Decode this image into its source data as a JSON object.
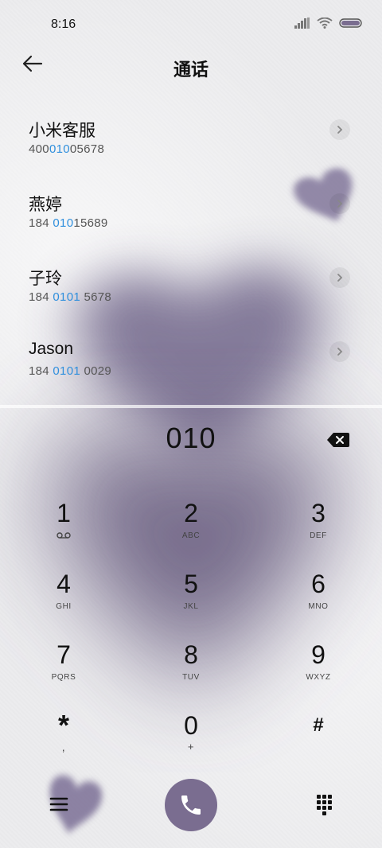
{
  "status_bar": {
    "time": "8:16"
  },
  "header": {
    "title": "通话"
  },
  "contacts": [
    {
      "name": "小米客服",
      "number_pre": "400",
      "number_match": "010",
      "number_post": "05678"
    },
    {
      "name": "燕婷",
      "number_pre": "184 ",
      "number_match": "010",
      "number_post": "15689"
    },
    {
      "name": "子玲",
      "number_pre": "184 ",
      "number_match": "0101",
      "number_post": " 5678"
    },
    {
      "name": "Jason",
      "number_pre": "184 ",
      "number_match": "0101",
      "number_post": " 0029"
    }
  ],
  "dialer": {
    "input": "010"
  },
  "keypad": [
    {
      "digit": "1",
      "letters": ""
    },
    {
      "digit": "2",
      "letters": "ABC"
    },
    {
      "digit": "3",
      "letters": "DEF"
    },
    {
      "digit": "4",
      "letters": "GHI"
    },
    {
      "digit": "5",
      "letters": "JKL"
    },
    {
      "digit": "6",
      "letters": "MNO"
    },
    {
      "digit": "7",
      "letters": "PQRS"
    },
    {
      "digit": "8",
      "letters": "TUV"
    },
    {
      "digit": "9",
      "letters": "WXYZ"
    },
    {
      "digit": "*",
      "letters": ","
    },
    {
      "digit": "0",
      "letters": "+"
    },
    {
      "digit": "#",
      "letters": ""
    }
  ],
  "colors": {
    "accent": "#7a6d90",
    "match": "#2f8fdd",
    "heart": "#6e6384"
  },
  "icons": {
    "back": "arrow-left-icon",
    "chevron": "chevron-right-icon",
    "backspace": "backspace-icon",
    "voicemail": "voicemail-icon",
    "menu": "menu-icon",
    "call": "phone-icon",
    "dialpad": "dialpad-icon"
  }
}
